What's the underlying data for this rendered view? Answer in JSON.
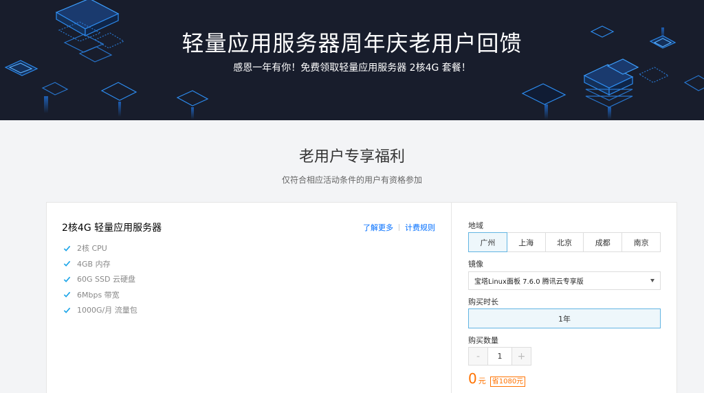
{
  "banner": {
    "title": "轻量应用服务器周年庆老用户回馈",
    "subtitle": "感恩一年有你！免费领取轻量应用服务器 2核4G 套餐！"
  },
  "section": {
    "title": "老用户专享福利",
    "subtitle": "仅符合相应活动条件的用户有资格参加"
  },
  "product": {
    "title": "2核4G 轻量应用服务器",
    "links": {
      "learn_more": "了解更多",
      "billing_rules": "计费规则"
    },
    "features": [
      "2核 CPU",
      "4GB 内存",
      "60G SSD 云硬盘",
      "6Mbps 带宽",
      "1000G/月 流量包"
    ]
  },
  "order": {
    "region_label": "地域",
    "regions": [
      "广州",
      "上海",
      "北京",
      "成都",
      "南京"
    ],
    "selected_region": "广州",
    "image_label": "镜像",
    "image_value": "宝塔Linux面板 7.6.0 腾讯云专享版",
    "duration_label": "购买时长",
    "duration_value": "1年",
    "quantity_label": "购买数量",
    "quantity_value": "1",
    "quantity_minus": "-",
    "quantity_plus": "+",
    "price": "0",
    "price_unit": "元",
    "savings": "省1080元"
  },
  "colors": {
    "accent": "#006eff",
    "check": "#1aa4e8",
    "price": "#ff7200",
    "banner_bg": "#181d2c",
    "selected_border": "#61b4e2",
    "selected_bg": "#eef7fb"
  },
  "icons": {
    "feature": "check-icon",
    "dropdown": "caret-down-icon"
  }
}
